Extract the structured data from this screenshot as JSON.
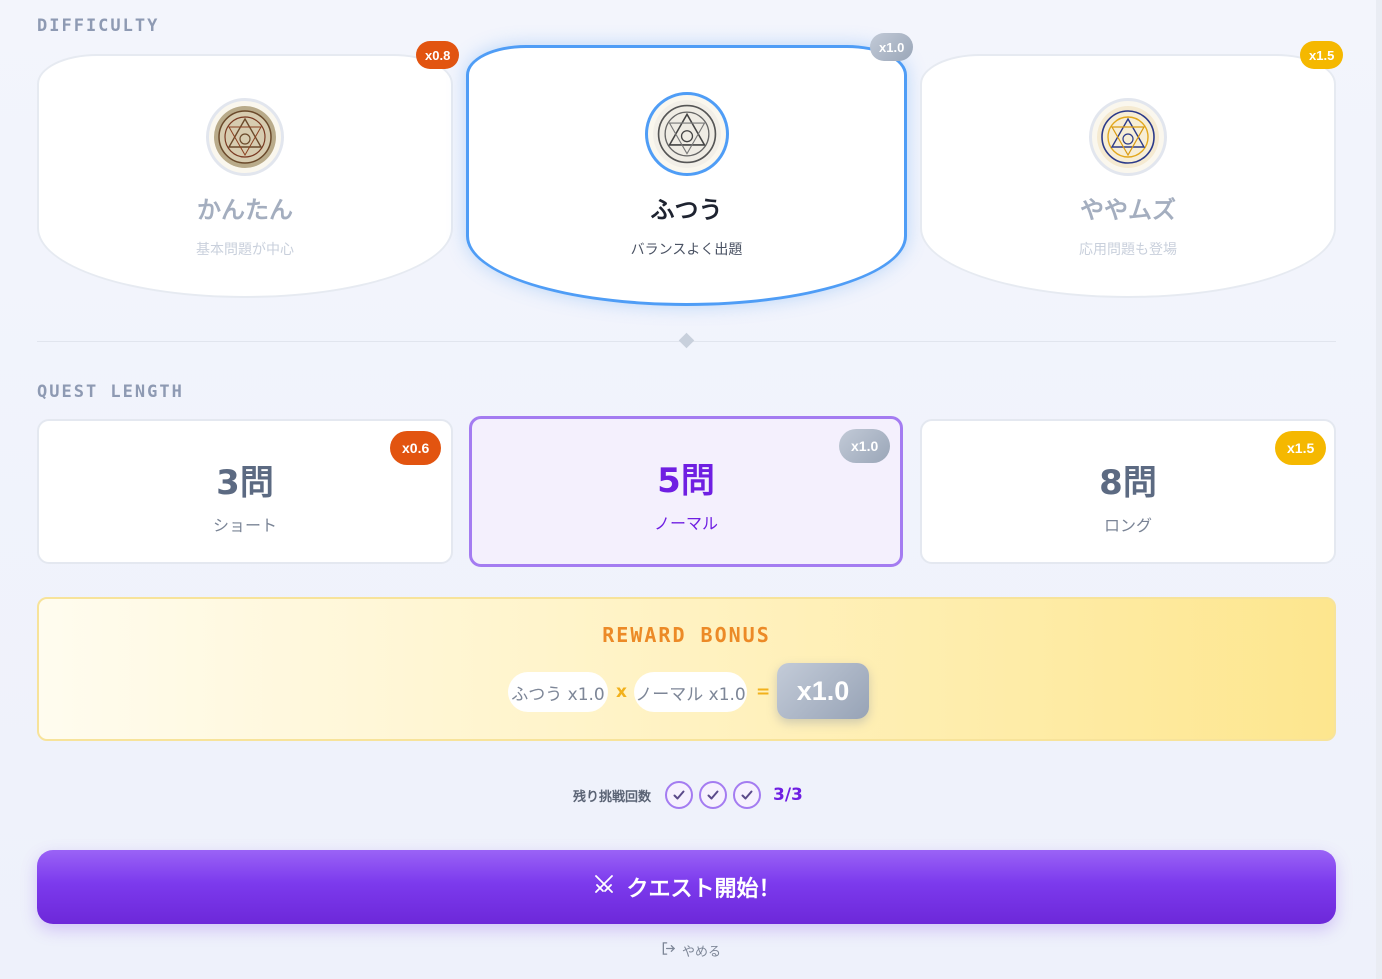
{
  "difficulty": {
    "title": "DIFFICULTY",
    "options": [
      {
        "name": "かんたん",
        "desc": "基本問題が中心",
        "badge": "x0.8",
        "emblem": "magic-circle-sepia"
      },
      {
        "name": "ふつう",
        "desc": "バランスよく出題",
        "badge": "x1.0",
        "emblem": "magic-circle-gray",
        "selected": true
      },
      {
        "name": "ややムズ",
        "desc": "応用問題も登場",
        "badge": "x1.5",
        "emblem": "magic-circle-gold"
      }
    ]
  },
  "quest_length": {
    "title": "QUEST LENGTH",
    "options": [
      {
        "count": "3問",
        "label": "ショート",
        "badge": "x0.6"
      },
      {
        "count": "5問",
        "label": "ノーマル",
        "badge": "x1.0",
        "selected": true
      },
      {
        "count": "8問",
        "label": "ロング",
        "badge": "x1.5"
      }
    ]
  },
  "reward": {
    "title": "REWARD BONUS",
    "difficulty_pill": "ふつう x1.0",
    "times_symbol": "x",
    "length_pill": "ノーマル x1.0",
    "equals_symbol": "=",
    "total": "x1.0"
  },
  "remaining": {
    "label": "残り挑戦回数",
    "count": "3/3",
    "checks_filled": 3,
    "checks_total": 3
  },
  "start_button": {
    "label": "クエスト開始！",
    "icon": "crossed-swords-icon"
  },
  "quit_button": {
    "label": "やめる",
    "icon": "exit-icon"
  },
  "colors": {
    "accent": "#7c3aed",
    "selected_blue": "#4f9df6",
    "badge_red": "#e25410",
    "badge_gold": "#f5b800",
    "reward_title": "#ec8a27"
  }
}
